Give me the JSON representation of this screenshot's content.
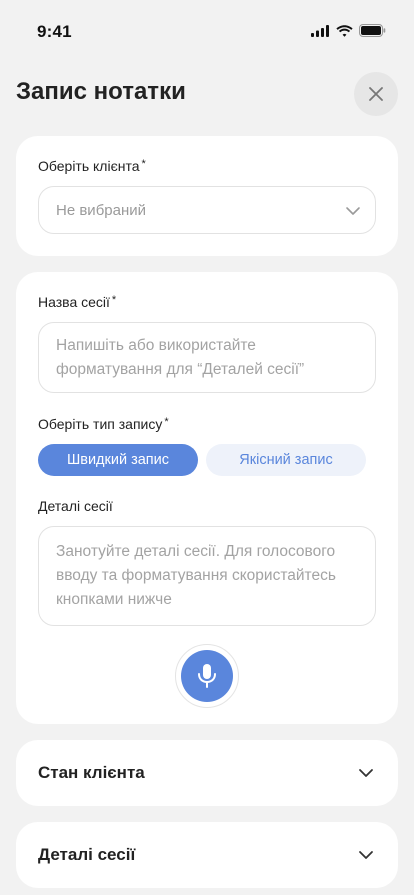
{
  "status_bar": {
    "time": "9:41",
    "icons": [
      "signal-icon",
      "wifi-icon",
      "battery-icon"
    ]
  },
  "header": {
    "title": "Запис нотатки",
    "close_icon": "close-icon"
  },
  "client_card": {
    "label": "Оберіть клієнта",
    "required_mark": "*",
    "select_value": "Не вибраний",
    "chevron_icon": "chevron-down-icon"
  },
  "session_card": {
    "name_label": "Назва сесії",
    "name_required": "*",
    "name_placeholder_line1": "Напишіть або використайте",
    "name_placeholder_line2": "форматування для “Деталей сесії”",
    "type_label": "Оберіть тип запису",
    "type_required": "*",
    "type_options": [
      "Швидкий запис",
      "Якісний запис"
    ],
    "type_selected": "Швидкий запис",
    "details_label": "Деталі сесії",
    "details_placeholder_line1": "Занотуйте деталі сесії. Для голосового",
    "details_placeholder_line2": "вводу та форматування скористайтесь",
    "details_placeholder_line3": "кнопками нижче",
    "mic_icon": "microphone-icon"
  },
  "accordions": [
    {
      "title": "Стан клієнта",
      "icon": "chevron-down-icon"
    },
    {
      "title": "Деталі сесії",
      "icon": "chevron-down-icon"
    }
  ],
  "colors": {
    "accent": "#5a86dc",
    "accent_light": "#eef2fa",
    "background": "#f2f2f2",
    "card": "#ffffff"
  }
}
